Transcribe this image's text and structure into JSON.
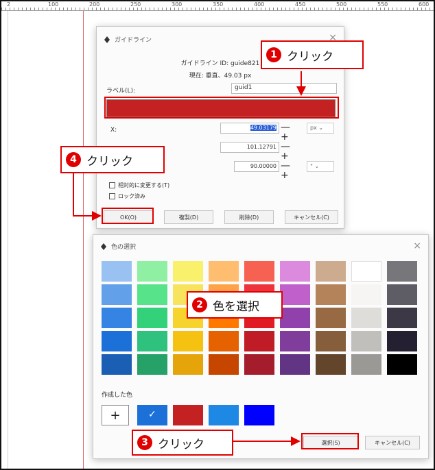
{
  "ruler": {
    "ticks": [
      "2",
      "100",
      "200",
      "250",
      "300",
      "350",
      "400",
      "450",
      "500",
      "550",
      "600"
    ]
  },
  "guide_dialog": {
    "title": "ガイドライン",
    "id_text": "ガイドライン ID: guide821",
    "current_text": "現在: 垂直、49.03 px",
    "label_caption": "ラベル(L):",
    "label_value": "guid1",
    "color_hex": "#c42222",
    "x_label": "X:",
    "x_value": "49.03179",
    "y_value": "101.12791",
    "angle_value": "90.00000",
    "unit_px": "px",
    "unit_deg": "°",
    "relative_checkbox": "相対的に変更する(T)",
    "lock_checkbox": "ロック済み",
    "buttons": {
      "ok": "OK(O)",
      "duplicate": "複製(D)",
      "delete": "削除(D)",
      "cancel": "キャンセル(C)"
    }
  },
  "color_dialog": {
    "title": "色の選択",
    "custom_title": "作成した色",
    "add_label": "+",
    "select_button": "選択(S)",
    "cancel_button": "キャンセル(C)",
    "palette_columns": [
      [
        "#99c1f1",
        "#62a0ea",
        "#3584e4",
        "#1c71d8",
        "#1a5fb4"
      ],
      [
        "#8ff0a4",
        "#57e389",
        "#33d17a",
        "#2ec27e",
        "#26a269"
      ],
      [
        "#f9f06b",
        "#f8e45c",
        "#f6d32d",
        "#f5c211",
        "#e5a50a"
      ],
      [
        "#ffbe6f",
        "#ffa348",
        "#ff7800",
        "#e66100",
        "#c64600"
      ],
      [
        "#f66151",
        "#ed333b",
        "#e01b24",
        "#c01c28",
        "#a51d2d"
      ],
      [
        "#dc8add",
        "#c061cb",
        "#9141ac",
        "#813d9c",
        "#613583"
      ],
      [
        "#cdab8f",
        "#b5835a",
        "#986a44",
        "#865e3c",
        "#63452c"
      ],
      [
        "#ffffff",
        "#f6f5f4",
        "#deddda",
        "#c0bfbc",
        "#9a9996"
      ],
      [
        "#77767b",
        "#5e5c64",
        "#3d3846",
        "#241f31",
        "#000000"
      ]
    ],
    "custom_colors": [
      "#1c71d8",
      "#c42222",
      "#1e88e5",
      "#0000ff"
    ],
    "selected_check": "✓"
  },
  "callouts": [
    {
      "num": "1",
      "text": "クリック"
    },
    {
      "num": "2",
      "text": "色を選択"
    },
    {
      "num": "3",
      "text": "クリック"
    },
    {
      "num": "4",
      "text": "クリック"
    }
  ],
  "icons": {
    "close": "×",
    "pen": "pen-icon"
  }
}
